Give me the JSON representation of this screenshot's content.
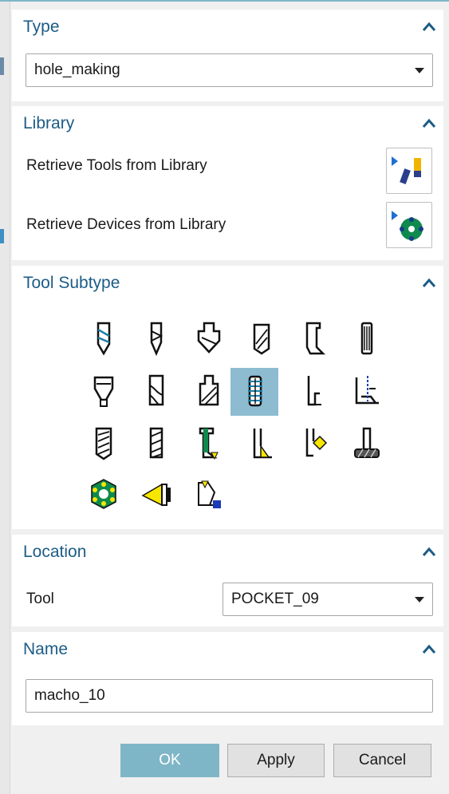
{
  "type_section": {
    "title": "Type",
    "selected": "hole_making"
  },
  "library_section": {
    "title": "Library",
    "items": [
      {
        "label": "Retrieve Tools from Library"
      },
      {
        "label": "Retrieve Devices from Library"
      }
    ]
  },
  "tool_subtype_section": {
    "title": "Tool Subtype",
    "icons": [
      "spot-drill-icon",
      "drill-icon",
      "step-drill-icon",
      "core-drill-icon",
      "counterbore-icon",
      "reamer-icon",
      "countersink-icon",
      "boring-bar-icon",
      "chamfer-mill-icon",
      "tap-icon",
      "back-counterbore-icon",
      "t-slot-thread-icon",
      "thread-mill-icon",
      "helix-mill-icon",
      "back-spot-icon",
      "back-chamfer-icon",
      "back-countersink-icon",
      "t-cutter-icon",
      "barrel-icon",
      "cone-icon",
      "soft-tool-icon"
    ],
    "selected_index": 9
  },
  "location_section": {
    "title": "Location",
    "tool_label": "Tool",
    "tool_value": "POCKET_09"
  },
  "name_section": {
    "title": "Name",
    "value": "macho_10"
  },
  "buttons": {
    "ok": "OK",
    "apply": "Apply",
    "cancel": "Cancel"
  },
  "colors": {
    "section_title": "#1d5c86",
    "selected_icon_bg": "#8dbcd0",
    "ok_button": "#7fb6c7"
  }
}
